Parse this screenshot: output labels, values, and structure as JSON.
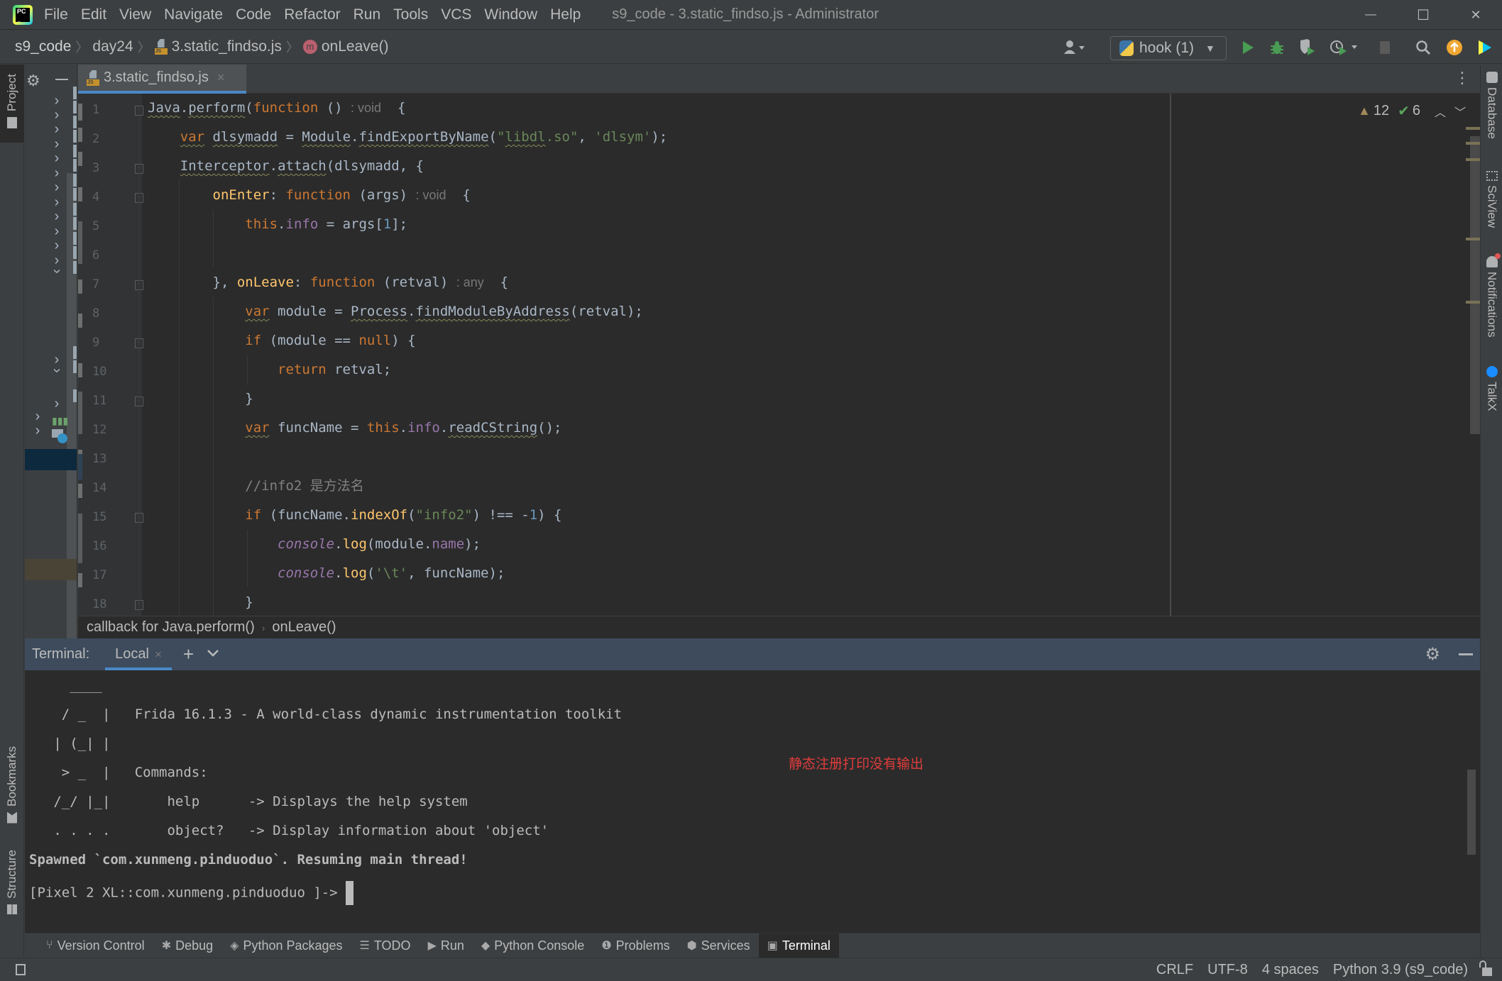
{
  "titlebar": {
    "app_icon": "pycharm-logo",
    "menu": [
      "File",
      "Edit",
      "View",
      "Navigate",
      "Code",
      "Refactor",
      "Run",
      "Tools",
      "VCS",
      "Window",
      "Help"
    ],
    "menu_mnemonics": [
      "F",
      "E",
      "V",
      "N",
      "C",
      "R",
      "u",
      "T",
      "S",
      "W",
      "H"
    ],
    "window_title": "s9_code - 3.static_findso.js - Administrator",
    "controls": {
      "minimize": "—",
      "maximize": "☐",
      "close": "✕"
    }
  },
  "navbar": {
    "breadcrumbs": [
      "s9_code",
      "day24",
      "3.static_findso.js",
      "onLeave()"
    ],
    "run_config": "hook (1)",
    "icons": [
      "user-icon",
      "run-icon",
      "debug-icon",
      "coverage-icon",
      "profile-icon",
      "stop-icon",
      "search-icon",
      "update-icon",
      "jetbrains-toolbox-icon"
    ]
  },
  "left_stripe": {
    "tabs": [
      "Project",
      "Bookmarks",
      "Structure"
    ]
  },
  "right_stripe": {
    "tabs": [
      "Database",
      "SciView",
      "Notifications",
      "TalkX"
    ]
  },
  "editor": {
    "tab": {
      "label": "3.static_findso.js",
      "close": "×"
    },
    "inspections": {
      "warnings": "12",
      "typos": "6"
    },
    "line_numbers": [
      "1",
      "2",
      "3",
      "4",
      "5",
      "6",
      "7",
      "8",
      "9",
      "10",
      "11",
      "12",
      "13",
      "14",
      "15",
      "16",
      "17",
      "18"
    ],
    "lines": [
      "Java.perform(function () : void  {",
      "    var dlsymadd = Module.findExportByName(\"libdl.so\", 'dlsym');",
      "    Interceptor.attach(dlsymadd, {",
      "        onEnter: function (args) : void  {",
      "            this.info = args[1];",
      "",
      "        }, onLeave: function (retval) : any  {",
      "            var module = Process.findModuleByAddress(retval);",
      "            if (module == null) {",
      "                return retval;",
      "            }",
      "            var funcName = this.info.readCString();",
      "",
      "            //info2 是方法名",
      "            if (funcName.indexOf(\"info2\") !== -1) {",
      "                console.log(module.name);",
      "                console.log('\\t', funcName);",
      "            }"
    ],
    "footer_crumbs": [
      "callback for Java.perform()",
      "onLeave()"
    ]
  },
  "terminal": {
    "label": "Terminal:",
    "tab": "Local",
    "tab_close": "×",
    "add": "+",
    "dropdown": "⌄",
    "lines": [
      "     ____",
      "    / _  |   Frida 16.1.3 - A world-class dynamic instrumentation toolkit",
      "   | (_| |",
      "    > _  |   Commands:",
      "   /_/ |_|       help      -> Displays the help system",
      "   . . . .       object?   -> Display information about 'object'",
      "Spawned `com.xunmeng.pinduoduo`. Resuming main thread!",
      "[Pixel 2 XL::com.xunmeng.pinduoduo ]-> "
    ],
    "annotation": "静态注册打印没有输出",
    "annotation_color": "#e03c3c"
  },
  "tool_windows": [
    {
      "label": "Version Control",
      "icon": "⑂"
    },
    {
      "label": "Debug",
      "icon": "✱"
    },
    {
      "label": "Python Packages",
      "icon": "◈"
    },
    {
      "label": "TODO",
      "icon": "☰"
    },
    {
      "label": "Run",
      "icon": "▶"
    },
    {
      "label": "Python Console",
      "icon": "◆"
    },
    {
      "label": "Problems",
      "icon": "❶"
    },
    {
      "label": "Services",
      "icon": "⬢"
    },
    {
      "label": "Terminal",
      "icon": "▣",
      "active": true
    }
  ],
  "statusbar": {
    "line_separator": "CRLF",
    "encoding": "UTF-8",
    "indent": "4 spaces",
    "interpreter": "Python 3.9 (s9_code)"
  },
  "colors": {
    "accent": "#4a88c7",
    "run_green": "#499c54",
    "keyword": "#cc7832",
    "string": "#6a8759",
    "function": "#ffc66d",
    "property": "#9876aa",
    "number": "#6897bb"
  }
}
